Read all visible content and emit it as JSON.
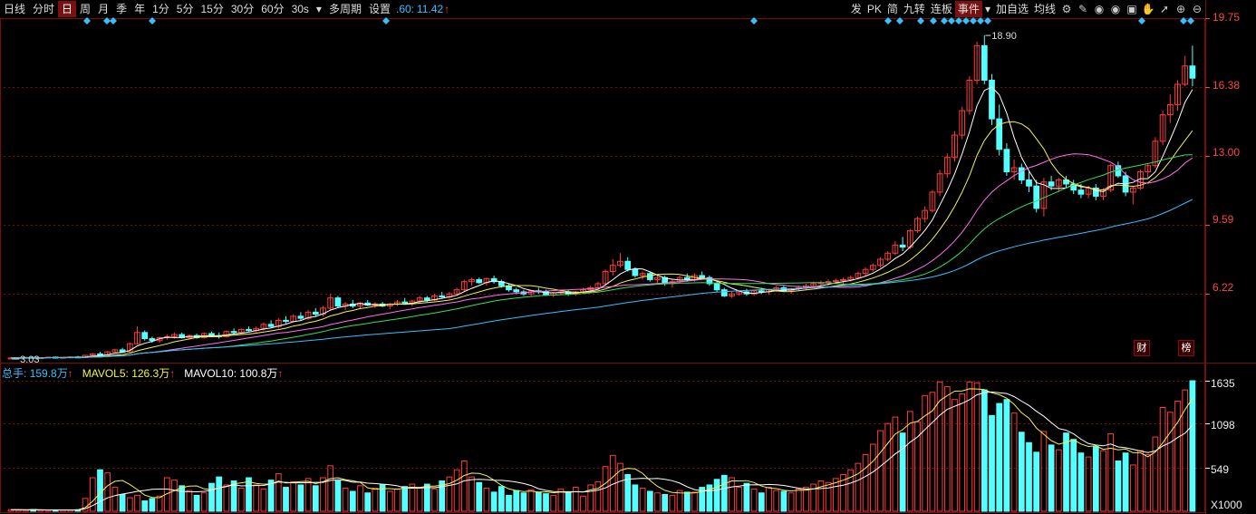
{
  "toolbar": {
    "items": [
      "日线",
      "分时",
      "日",
      "周",
      "月",
      "季",
      "年",
      "1分",
      "5分",
      "15分",
      "30分",
      "60分",
      "30s",
      "多周期",
      "设置"
    ],
    "active_index": 2,
    "ma_label": ".60:",
    "ma_value": "11.42",
    "ma_arrow": "↑"
  },
  "right_tools": {
    "items": [
      "发",
      "PK",
      "简",
      "九转",
      "连板",
      "事件",
      "加自选",
      "均线"
    ],
    "active_index": 5,
    "icons": [
      "gear-icon",
      "pen-icon",
      "eye-icon",
      "eye-icon",
      "shape-icon",
      "hand-icon",
      "cursor-icon",
      "zoom-in-icon",
      "zoom-out-icon"
    ]
  },
  "price_axis": [
    "19.75",
    "16.38",
    "13.00",
    "9.59",
    "6.22"
  ],
  "price_annotations": {
    "high": "18.90",
    "low": "3.03"
  },
  "badges": {
    "cai": "财",
    "bang": "榜"
  },
  "volume_header": {
    "total_label": "总手:",
    "total_value": "159.8万",
    "ma5_label": "MAVOL5:",
    "ma5_value": "126.3万",
    "ma10_label": "MAVOL10:",
    "ma10_value": "100.8万",
    "arrow": "↑"
  },
  "volume_axis": [
    "1635",
    "1098",
    "549",
    "X1000"
  ],
  "colors": {
    "up": "#ff3b3b",
    "down": "#54ffff",
    "ma5": "#ffffff",
    "ma10": "#f3f34a",
    "ma20": "#ff6ff0",
    "ma30": "#35e05a",
    "ma60": "#35c0ff",
    "grid": "#7a0c0c"
  },
  "chart_data": {
    "type": "candlestick",
    "price_ylim": [
      3.0,
      19.75
    ],
    "volume_ylim": [
      0,
      1635
    ],
    "candles": [
      [
        3.05,
        3.1,
        3.0,
        3.05
      ],
      [
        3.05,
        3.08,
        3.02,
        3.06
      ],
      [
        3.06,
        3.1,
        3.03,
        3.08
      ],
      [
        3.08,
        3.1,
        3.04,
        3.05
      ],
      [
        3.05,
        3.08,
        3.02,
        3.06
      ],
      [
        3.06,
        3.1,
        3.03,
        3.09
      ],
      [
        3.09,
        3.12,
        3.05,
        3.07
      ],
      [
        3.07,
        3.1,
        3.03,
        3.08
      ],
      [
        3.08,
        3.12,
        3.05,
        3.1
      ],
      [
        3.1,
        3.15,
        3.05,
        3.08
      ],
      [
        3.08,
        3.2,
        3.05,
        3.18
      ],
      [
        3.18,
        3.3,
        3.1,
        3.25
      ],
      [
        3.25,
        3.35,
        3.15,
        3.2
      ],
      [
        3.2,
        3.4,
        3.15,
        3.35
      ],
      [
        3.35,
        3.5,
        3.3,
        3.45
      ],
      [
        3.45,
        3.55,
        3.3,
        3.35
      ],
      [
        3.35,
        3.8,
        3.3,
        3.75
      ],
      [
        3.75,
        4.6,
        3.7,
        4.3
      ],
      [
        4.3,
        4.4,
        3.9,
        4.0
      ],
      [
        4.0,
        4.1,
        3.8,
        3.9
      ],
      [
        3.9,
        4.1,
        3.8,
        4.05
      ],
      [
        4.05,
        4.2,
        3.95,
        4.1
      ],
      [
        4.1,
        4.3,
        4.0,
        4.2
      ],
      [
        4.2,
        4.3,
        4.0,
        4.05
      ],
      [
        4.05,
        4.2,
        3.95,
        4.15
      ],
      [
        4.15,
        4.25,
        4.0,
        4.05
      ],
      [
        4.05,
        4.3,
        4.0,
        4.25
      ],
      [
        4.25,
        4.35,
        4.1,
        4.15
      ],
      [
        4.15,
        4.3,
        4.0,
        4.1
      ],
      [
        4.1,
        4.4,
        4.05,
        4.35
      ],
      [
        4.35,
        4.5,
        4.2,
        4.3
      ],
      [
        4.3,
        4.5,
        4.2,
        4.45
      ],
      [
        4.45,
        4.6,
        4.35,
        4.4
      ],
      [
        4.4,
        4.6,
        4.3,
        4.5
      ],
      [
        4.5,
        4.8,
        4.4,
        4.7
      ],
      [
        4.7,
        4.9,
        4.55,
        4.6
      ],
      [
        4.6,
        5.0,
        4.5,
        4.9
      ],
      [
        4.9,
        5.1,
        4.75,
        4.85
      ],
      [
        4.85,
        5.2,
        4.8,
        5.1
      ],
      [
        5.1,
        5.3,
        4.9,
        5.0
      ],
      [
        5.0,
        5.4,
        4.9,
        5.3
      ],
      [
        5.3,
        5.5,
        5.1,
        5.2
      ],
      [
        5.2,
        5.6,
        5.1,
        5.5
      ],
      [
        5.5,
        6.2,
        5.4,
        6.0
      ],
      [
        6.0,
        6.1,
        5.5,
        5.6
      ],
      [
        5.6,
        5.8,
        5.4,
        5.7
      ],
      [
        5.7,
        5.9,
        5.5,
        5.6
      ],
      [
        5.6,
        5.8,
        5.45,
        5.75
      ],
      [
        5.75,
        5.9,
        5.6,
        5.65
      ],
      [
        5.65,
        5.8,
        5.5,
        5.7
      ],
      [
        5.7,
        5.8,
        5.55,
        5.6
      ],
      [
        5.6,
        5.75,
        5.45,
        5.7
      ],
      [
        5.7,
        5.9,
        5.6,
        5.8
      ],
      [
        5.8,
        6.0,
        5.7,
        5.75
      ],
      [
        5.75,
        5.9,
        5.6,
        5.85
      ],
      [
        5.85,
        6.1,
        5.75,
        6.0
      ],
      [
        6.0,
        6.1,
        5.8,
        5.9
      ],
      [
        5.9,
        6.2,
        5.85,
        6.1
      ],
      [
        6.1,
        6.3,
        6.0,
        6.05
      ],
      [
        6.05,
        6.3,
        5.95,
        6.2
      ],
      [
        6.2,
        6.5,
        6.1,
        6.4
      ],
      [
        6.4,
        6.9,
        6.3,
        6.8
      ],
      [
        6.8,
        7.0,
        6.6,
        6.9
      ],
      [
        6.9,
        7.0,
        6.7,
        6.75
      ],
      [
        6.75,
        7.0,
        6.6,
        6.95
      ],
      [
        6.95,
        7.1,
        6.7,
        6.8
      ],
      [
        6.8,
        6.9,
        6.5,
        6.6
      ],
      [
        6.6,
        6.7,
        6.3,
        6.4
      ],
      [
        6.4,
        6.5,
        6.2,
        6.3
      ],
      [
        6.3,
        6.4,
        6.1,
        6.2
      ],
      [
        6.2,
        6.4,
        6.1,
        6.35
      ],
      [
        6.35,
        6.5,
        6.2,
        6.3
      ],
      [
        6.3,
        6.4,
        6.1,
        6.15
      ],
      [
        6.15,
        6.3,
        6.05,
        6.25
      ],
      [
        6.25,
        6.4,
        6.15,
        6.3
      ],
      [
        6.3,
        6.4,
        6.1,
        6.2
      ],
      [
        6.2,
        6.35,
        6.1,
        6.3
      ],
      [
        6.3,
        6.5,
        6.2,
        6.4
      ],
      [
        6.4,
        6.6,
        6.3,
        6.5
      ],
      [
        6.5,
        6.8,
        6.4,
        6.7
      ],
      [
        6.7,
        7.4,
        6.6,
        7.3
      ],
      [
        7.3,
        7.9,
        7.1,
        7.6
      ],
      [
        7.6,
        8.2,
        7.5,
        7.8
      ],
      [
        7.8,
        8.0,
        7.3,
        7.4
      ],
      [
        7.4,
        7.5,
        7.0,
        7.1
      ],
      [
        7.1,
        7.3,
        6.9,
        7.2
      ],
      [
        7.2,
        7.3,
        6.8,
        6.9
      ],
      [
        6.9,
        7.1,
        6.7,
        7.0
      ],
      [
        7.0,
        7.1,
        6.6,
        6.7
      ],
      [
        6.7,
        6.9,
        6.5,
        6.8
      ],
      [
        6.8,
        7.1,
        6.7,
        7.0
      ],
      [
        7.0,
        7.2,
        6.8,
        6.9
      ],
      [
        6.9,
        7.2,
        6.8,
        7.1
      ],
      [
        7.1,
        7.3,
        6.9,
        7.0
      ],
      [
        7.0,
        7.1,
        6.6,
        6.7
      ],
      [
        6.7,
        6.8,
        6.3,
        6.4
      ],
      [
        6.4,
        6.5,
        6.05,
        6.1
      ],
      [
        6.1,
        6.3,
        6.0,
        6.2
      ],
      [
        6.2,
        6.4,
        6.1,
        6.3
      ],
      [
        6.3,
        6.45,
        6.1,
        6.2
      ],
      [
        6.2,
        6.4,
        6.1,
        6.35
      ],
      [
        6.35,
        6.5,
        6.2,
        6.3
      ],
      [
        6.3,
        6.45,
        6.15,
        6.4
      ],
      [
        6.4,
        6.6,
        6.3,
        6.5
      ],
      [
        6.5,
        6.6,
        6.3,
        6.35
      ],
      [
        6.35,
        6.5,
        6.2,
        6.45
      ],
      [
        6.45,
        6.6,
        6.35,
        6.5
      ],
      [
        6.5,
        6.7,
        6.4,
        6.6
      ],
      [
        6.6,
        6.8,
        6.5,
        6.7
      ],
      [
        6.7,
        6.85,
        6.6,
        6.75
      ],
      [
        6.75,
        6.9,
        6.6,
        6.8
      ],
      [
        6.8,
        6.95,
        6.7,
        6.85
      ],
      [
        6.85,
        7.0,
        6.7,
        6.9
      ],
      [
        6.9,
        7.1,
        6.8,
        7.0
      ],
      [
        7.0,
        7.3,
        6.9,
        7.2
      ],
      [
        7.2,
        7.5,
        7.1,
        7.4
      ],
      [
        7.4,
        7.7,
        7.3,
        7.6
      ],
      [
        7.6,
        8.0,
        7.5,
        7.9
      ],
      [
        7.9,
        8.3,
        7.8,
        8.2
      ],
      [
        8.2,
        8.8,
        8.1,
        8.6
      ],
      [
        8.6,
        9.0,
        8.3,
        8.5
      ],
      [
        8.5,
        9.4,
        8.4,
        9.3
      ],
      [
        9.3,
        10.0,
        9.2,
        9.9
      ],
      [
        9.9,
        10.5,
        9.7,
        10.3
      ],
      [
        10.3,
        11.3,
        10.2,
        11.2
      ],
      [
        11.2,
        12.3,
        11.0,
        12.1
      ],
      [
        12.1,
        13.1,
        11.9,
        12.9
      ],
      [
        12.9,
        14.2,
        12.7,
        14.0
      ],
      [
        14.0,
        15.4,
        13.8,
        15.2
      ],
      [
        15.2,
        16.9,
        15.0,
        16.7
      ],
      [
        16.7,
        18.6,
        16.5,
        18.4
      ],
      [
        18.4,
        18.9,
        16.5,
        16.7
      ],
      [
        16.7,
        17.0,
        14.5,
        14.8
      ],
      [
        14.8,
        15.5,
        13.0,
        13.3
      ],
      [
        13.3,
        13.6,
        12.0,
        12.2
      ],
      [
        12.2,
        12.8,
        11.8,
        12.4
      ],
      [
        12.4,
        12.6,
        11.6,
        11.8
      ],
      [
        11.8,
        12.2,
        11.2,
        11.5
      ],
      [
        11.5,
        11.8,
        10.2,
        10.4
      ],
      [
        10.4,
        11.9,
        10.0,
        11.7
      ],
      [
        11.7,
        12.0,
        11.3,
        11.5
      ],
      [
        11.5,
        11.9,
        11.2,
        11.8
      ],
      [
        11.8,
        12.0,
        11.4,
        11.6
      ],
      [
        11.6,
        11.8,
        11.1,
        11.3
      ],
      [
        11.3,
        11.6,
        10.9,
        11.1
      ],
      [
        11.1,
        11.5,
        10.9,
        11.4
      ],
      [
        11.4,
        11.6,
        10.8,
        11.0
      ],
      [
        11.0,
        11.4,
        10.8,
        11.3
      ],
      [
        11.3,
        12.6,
        11.2,
        12.5
      ],
      [
        12.5,
        12.7,
        11.9,
        12.0
      ],
      [
        12.0,
        12.2,
        11.0,
        11.2
      ],
      [
        11.2,
        11.5,
        10.6,
        11.4
      ],
      [
        11.4,
        12.3,
        11.3,
        12.2
      ],
      [
        12.2,
        12.6,
        11.9,
        12.5
      ],
      [
        12.5,
        13.9,
        12.4,
        13.7
      ],
      [
        13.7,
        15.2,
        13.5,
        15.0
      ],
      [
        15.0,
        16.0,
        14.6,
        15.5
      ],
      [
        15.5,
        16.7,
        15.2,
        16.5
      ],
      [
        16.5,
        17.9,
        16.4,
        17.4
      ],
      [
        17.4,
        18.4,
        16.4,
        16.8
      ]
    ],
    "volumes": [
      20,
      18,
      15,
      22,
      16,
      14,
      18,
      15,
      17,
      20,
      160,
      420,
      520,
      480,
      300,
      210,
      170,
      200,
      130,
      160,
      190,
      420,
      390,
      320,
      260,
      200,
      230,
      350,
      430,
      330,
      380,
      290,
      420,
      330,
      280,
      390,
      470,
      300,
      370,
      330,
      410,
      320,
      420,
      570,
      380,
      290,
      250,
      320,
      230,
      290,
      330,
      250,
      280,
      310,
      340,
      300,
      340,
      280,
      380,
      430,
      520,
      630,
      430,
      360,
      290,
      240,
      310,
      200,
      260,
      230,
      270,
      240,
      220,
      200,
      280,
      240,
      300,
      190,
      330,
      370,
      560,
      700,
      600,
      460,
      330,
      290,
      250,
      230,
      210,
      200,
      260,
      240,
      240,
      300,
      330,
      400,
      450,
      420,
      300,
      350,
      280,
      230,
      300,
      260,
      250,
      230,
      280,
      300,
      340,
      380,
      360,
      410,
      460,
      520,
      600,
      710,
      840,
      1010,
      1100,
      1180,
      980,
      1250,
      1120,
      1450,
      1490,
      1620,
      1560,
      1400,
      1470,
      1620,
      1610,
      1520,
      1200,
      1350,
      1400,
      1230,
      990,
      860,
      740,
      1000,
      830,
      770,
      980,
      900,
      730,
      680,
      810,
      760,
      970,
      630,
      730,
      580,
      760,
      710,
      930,
      1300,
      1240,
      1380,
      1520,
      1635
    ],
    "ma_periods": [
      5,
      10,
      20,
      30,
      60
    ]
  }
}
